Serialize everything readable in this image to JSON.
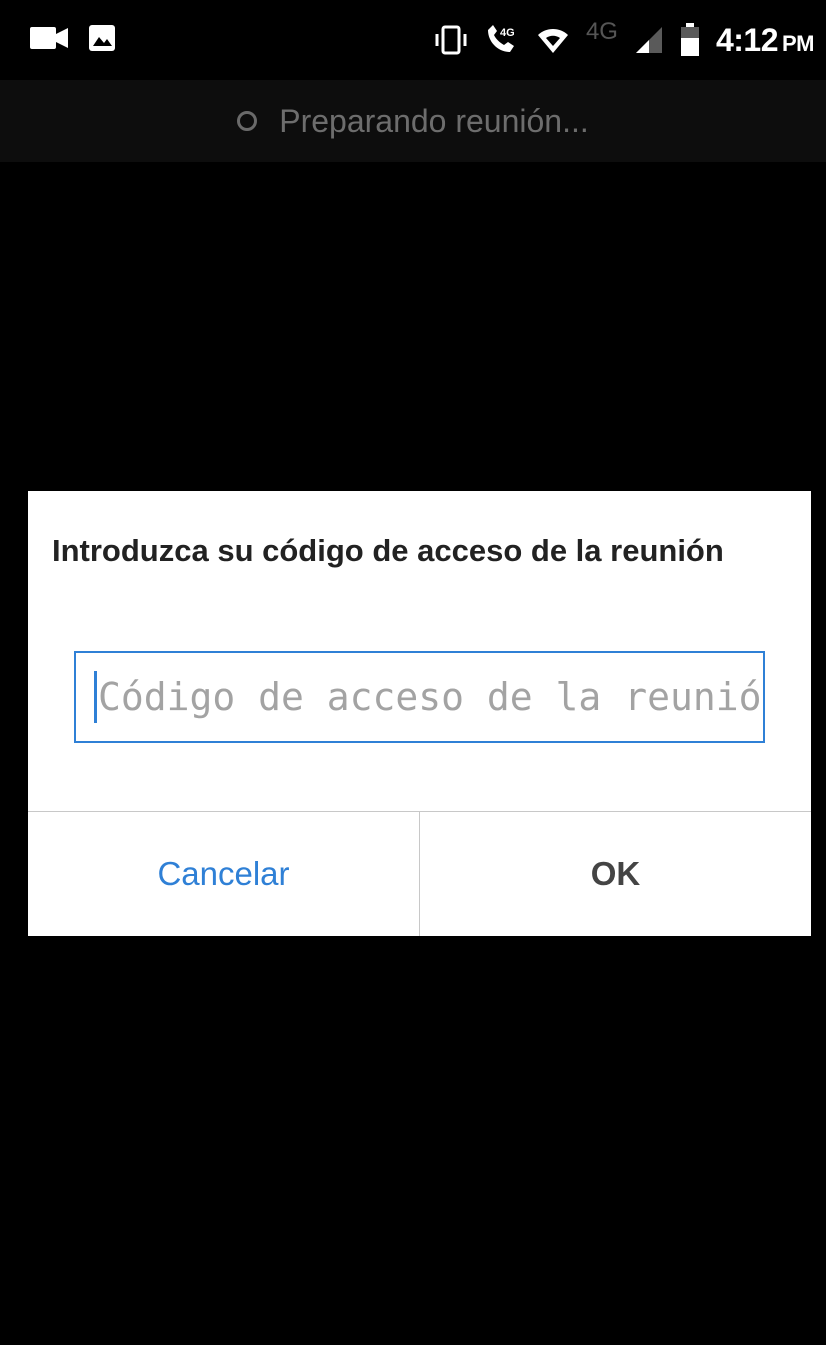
{
  "status_bar": {
    "left_icons": [
      "video-camera-icon",
      "image-icon"
    ],
    "right_icons": [
      "vibrate-icon",
      "volte-call-icon",
      "wifi-icon",
      "signal-icon",
      "battery-icon"
    ],
    "volte_label": "4G",
    "network_label": "4G",
    "time": "4:12",
    "ampm": "PM"
  },
  "meeting": {
    "status_text": "Preparando reunión..."
  },
  "dialog": {
    "title": "Introduzca su código de acceso de la reunión",
    "passcode_value": "",
    "passcode_placeholder": "Código de acceso de la reunión",
    "cancel_label": "Cancelar",
    "ok_label": "OK"
  },
  "colors": {
    "background": "#000000",
    "accent": "#2f80d6",
    "dialog_background": "#ffffff",
    "title_text": "#222222",
    "placeholder_text": "#a3a3a3",
    "ok_text": "#444444"
  }
}
